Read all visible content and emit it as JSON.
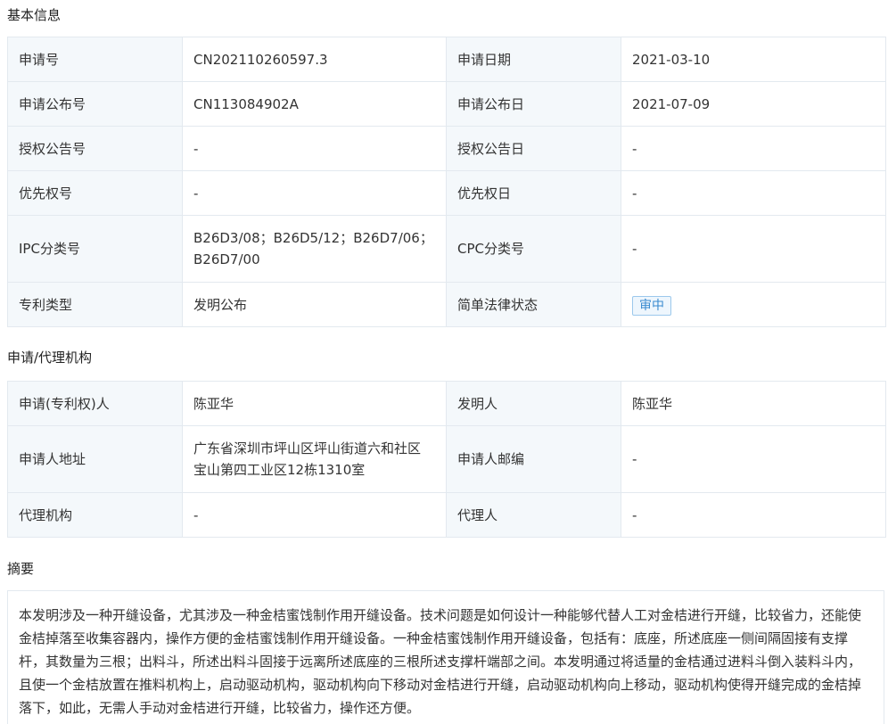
{
  "sections": {
    "basic": "基本信息",
    "agency": "申请/代理机构",
    "abstract": "摘要"
  },
  "basic": {
    "app_no_label": "申请号",
    "app_no": "CN202110260597.3",
    "app_date_label": "申请日期",
    "app_date": "2021-03-10",
    "pub_no_label": "申请公布号",
    "pub_no": "CN113084902A",
    "pub_date_label": "申请公布日",
    "pub_date": "2021-07-09",
    "grant_no_label": "授权公告号",
    "grant_no": "-",
    "grant_date_label": "授权公告日",
    "grant_date": "-",
    "priority_no_label": "优先权号",
    "priority_no": "-",
    "priority_date_label": "优先权日",
    "priority_date": "-",
    "ipc_label": "IPC分类号",
    "ipc_line1": "B26D3/08；B26D5/12；B26D7/06；",
    "ipc_line2": "B26D7/00",
    "cpc_label": "CPC分类号",
    "cpc": "-",
    "type_label": "专利类型",
    "type": "发明公布",
    "legal_status_label": "简单法律状态",
    "legal_status": "审中"
  },
  "agency": {
    "applicant_label": "申请(专利权)人",
    "applicant": "陈亚华",
    "inventor_label": "发明人",
    "inventor": "陈亚华",
    "address_label": "申请人地址",
    "address_line1": "广东省深圳市坪山区坪山街道六和社区",
    "address_line2": "宝山第四工业区12栋1310室",
    "postcode_label": "申请人邮编",
    "postcode": "-",
    "agency_label": "代理机构",
    "agency": "-",
    "agent_label": "代理人",
    "agent": "-"
  },
  "abstract": {
    "text": "本发明涉及一种开缝设备，尤其涉及一种金桔蜜饯制作用开缝设备。技术问题是如何设计一种能够代替人工对金桔进行开缝，比较省力，还能使金桔掉落至收集容器内，操作方便的金桔蜜饯制作用开缝设备。一种金桔蜜饯制作用开缝设备，包括有：底座，所述底座一侧间隔固接有支撑杆，其数量为三根；出料斗，所述出料斗固接于远离所述底座的三根所述支撑杆端部之间。本发明通过将适量的金桔通过进料斗倒入装料斗内，且使一个金桔放置在推料机构上，启动驱动机构，驱动机构向下移动对金桔进行开缝，启动驱动机构向上移动，驱动机构使得开缝完成的金桔掉落下，如此，无需人手动对金桔进行开缝，比较省力，操作还方便。"
  }
}
